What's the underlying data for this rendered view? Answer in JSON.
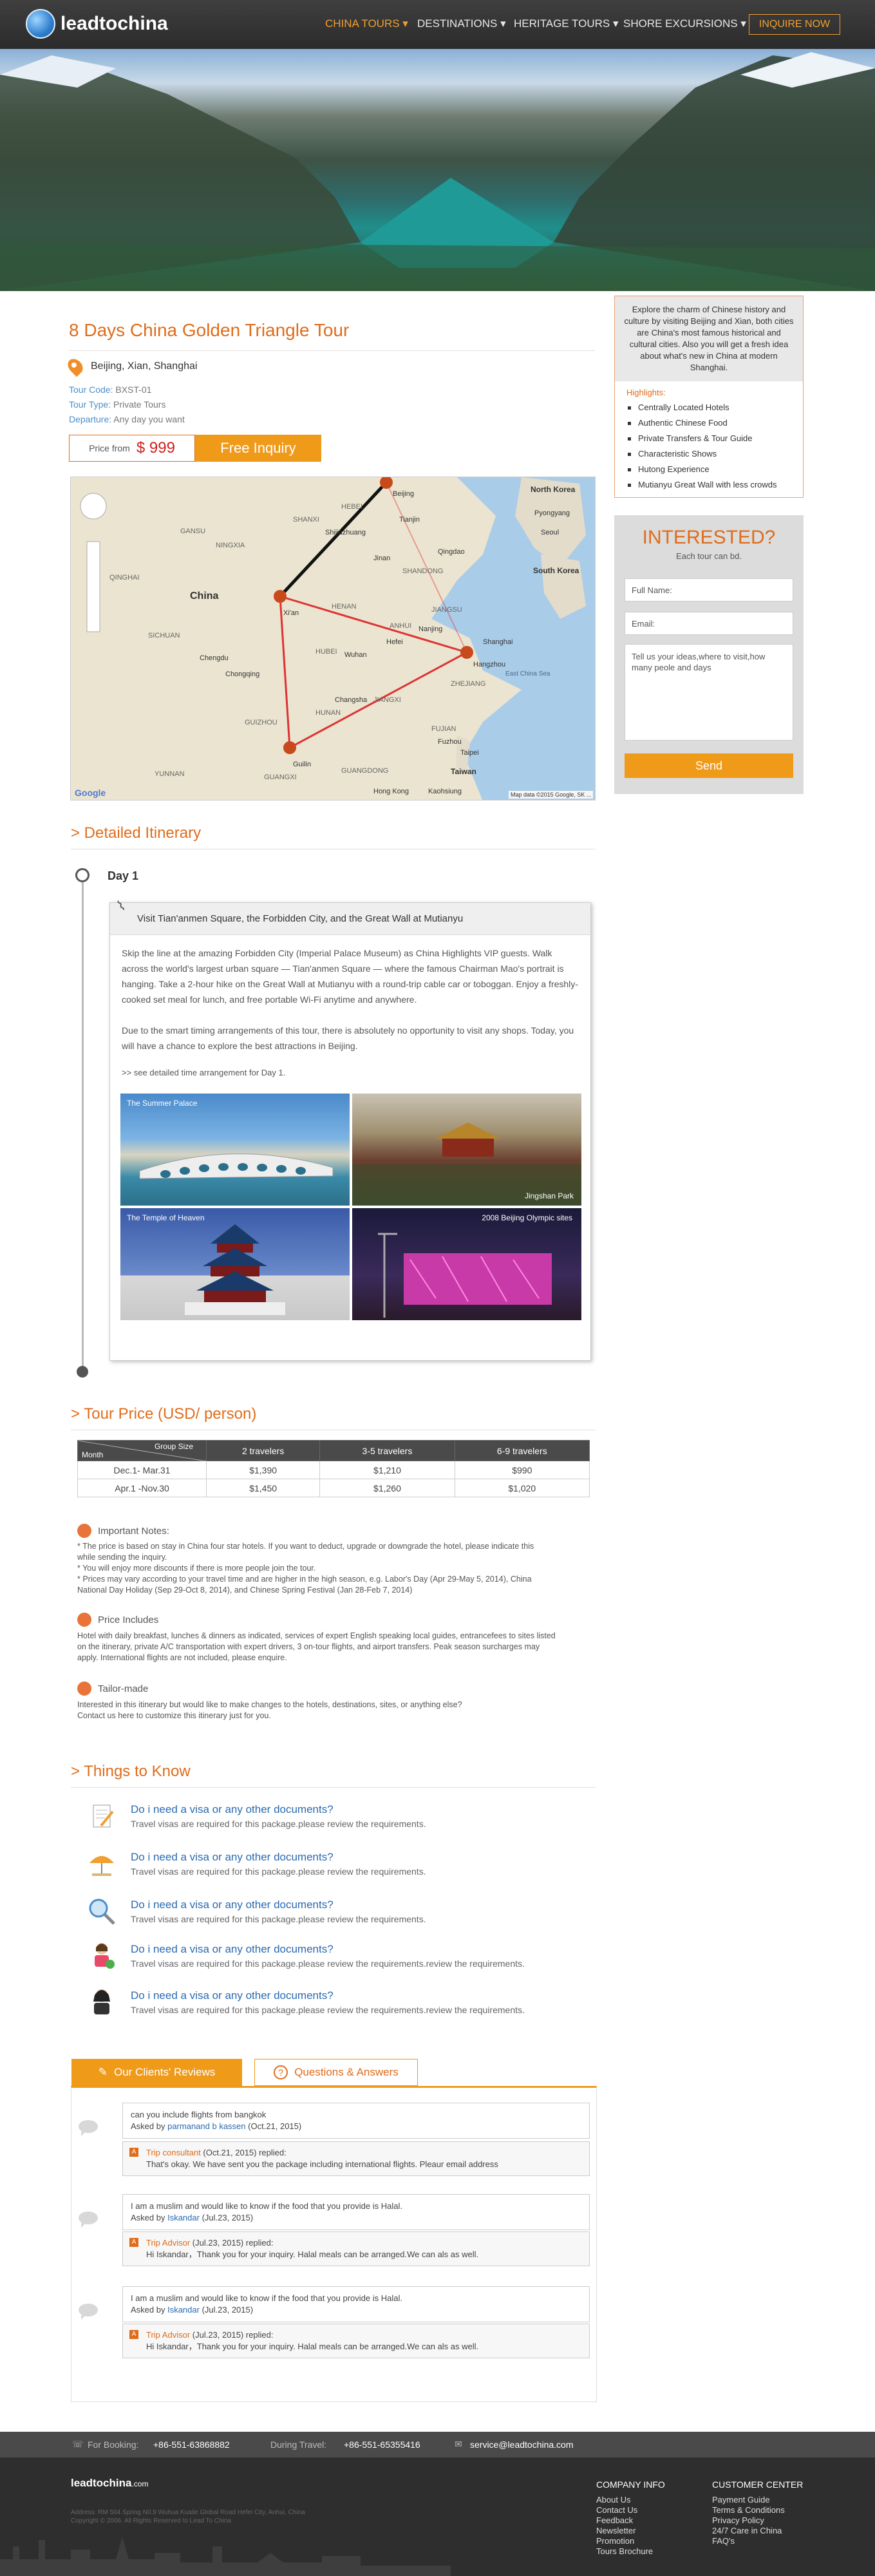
{
  "nav": {
    "logo": "leadtochina",
    "items": [
      "CHINA TOURS",
      "DESTINATIONS",
      "HERITAGE TOURS",
      "SHORE EXCURSIONS"
    ],
    "inquire": "INQUIRE NOW"
  },
  "tour": {
    "title": "8 Days China Golden Triangle Tour",
    "location": "Beijing, Xian, Shanghai",
    "code_label": "Tour Code:",
    "code": "BXST-01",
    "type_label": "Tour Type:",
    "type": "Private Tours",
    "dep_label": "Departure:",
    "departure": "Any day you want",
    "price_from": "Price from",
    "price": "$ 999",
    "free_inquiry": "Free Inquiry"
  },
  "map": {
    "labels": [
      "Beijing",
      "Tianjin",
      "North Korea",
      "Pyongyang",
      "Seoul",
      "South Korea",
      "SHANDONG",
      "Jinan",
      "Shijiazhuang",
      "GANSU",
      "NINGXIA",
      "SHANXI",
      "HEBEI",
      "Qingdao",
      "China",
      "Xi'an",
      "HENAN",
      "JIANGSU",
      "Nanjing",
      "Hefei",
      "Shanghai",
      "Hangzhou",
      "Wuhan",
      "Chengdu",
      "Chongqing",
      "HUBEI",
      "ANHUI",
      "ZHEJIANG",
      "HUNAN",
      "JIANGXI",
      "East China Sea",
      "GUIZHOU",
      "Changsha",
      "Guilin",
      "FUJIAN",
      "Fuzhou",
      "Taipei",
      "Taiwan",
      "YUNNAN",
      "GUANGXI",
      "GUANGDONG",
      "Hong Kong",
      "Kaohsiung",
      "QINGHAI",
      "SICHUAN"
    ],
    "footer": "Map data ©2015 Google, SK ...",
    "logo": "Google"
  },
  "sidebar": {
    "intro": "Explore the charm of Chinese history and culture by visiting Beijing and Xian, both cities are China's most famous historical and cultural cities. Also you will get a fresh idea about what's new in China at modern Shanghai.",
    "hl_title": "Highlights:",
    "highlights": [
      "Centrally Located Hotels",
      "Authentic Chinese Food",
      "Private Transfers & Tour Guide",
      "Characteristic Shows",
      "Hutong Experience",
      "Mutianyu Great Wall with less crowds"
    ],
    "int_title": "INTERESTED?",
    "int_sub": "Each tour can bd.",
    "name_ph": "Full Name:",
    "email_ph": "Email:",
    "msg_ph": "Tell us your ideas,where to visit,how many peole and days",
    "send": "Send"
  },
  "itinerary": {
    "title": "> Detailed Itinerary",
    "day": "Day 1",
    "head": "Visit Tian'anmen Square, the Forbidden City, and the Great Wall at Mutianyu",
    "p1": "Skip the line at the amazing Forbidden City (Imperial Palace Museum) as China Highlights VIP guests. Walk across the world's largest urban square — Tian'anmen Square — where the famous Chairman Mao's portrait is hanging. Take a 2-hour hike on the Great Wall at Mutianyu with a round-trip cable car or toboggan. Enjoy a freshly-cooked set meal for lunch, and free portable Wi-Fi anytime and anywhere.",
    "p2": "Due to the smart timing arrangements of this tour, there is absolutely no opportunity to visit any shops. Today, you will have a chance to explore the best attractions in Beijing.",
    "p3": ">> see detailed time arrangement for Day 1.",
    "photos": [
      "The Summer Palace",
      "Jingshan Park",
      "The Temple of Heaven",
      "2008 Beijing Olympic sites"
    ]
  },
  "price": {
    "title": "> Tour Price (USD/ person)",
    "corner_top": "Group Size",
    "corner_bottom": "Month",
    "cols": [
      "2 travelers",
      "3-5 travelers",
      "6-9 travelers"
    ],
    "rows": [
      [
        "Dec.1- Mar.31",
        "$1,390",
        "$1,210",
        "$990"
      ],
      [
        "Apr.1 -Nov.30",
        "$1,450",
        "$1,260",
        "$1,020"
      ]
    ]
  },
  "notes": {
    "imp_title": "Important Notes:",
    "imp1": "* The price is based on stay in China four star hotels. If you want to deduct, upgrade or downgrade the hotel,    please indicate this",
    "imp1b": "   while sending the inquiry.",
    "imp2": "* You will enjoy more discounts if there is more people join the tour.",
    "imp3": "* Prices may vary according to your travel time and are higher in the high season, e.g. Labor's Day (Apr 29-May 5, 2014), China",
    "imp3b": "  National Day Holiday (Sep 29-Oct 8, 2014), and Chinese Spring Festival (Jan 28-Feb 7, 2014)",
    "inc_title": "Price Includes",
    "inc1": "Hotel with daily breakfast, lunches & dinners as indicated, services of expert English speaking local guides, entrancefees to sites listed",
    "inc2": "on the itinerary, private A/C transportation with expert drivers, 3 on-tour flights, and airport transfers. Peak season surcharges may",
    "inc3": "apply. International flights are not included, please enquire.",
    "tm_title": "Tailor-made",
    "tm1": "Interested in this itinerary but would like to make changes to the hotels, destinations, sites, or anything else?",
    "tm2": "Contact us here to customize this itinerary just for you."
  },
  "know": {
    "title": "> Things to Know",
    "items": [
      {
        "q": "Do i need a visa or any other documents?",
        "a": "Travel visas are required for this package.please review the requirements.",
        "icon": "document-pen-icon"
      },
      {
        "q": "Do i need a visa or any other documents?",
        "a": "Travel visas are required for this package.please review the requirements.",
        "icon": "sun-umbrella-icon"
      },
      {
        "q": "Do i need a visa or any other documents?",
        "a": "Travel visas are required for this package.please review the requirements.",
        "icon": "magnifier-icon"
      },
      {
        "q": "Do i need a visa or any other documents?",
        "a": "Travel visas are required for this package.please review the requirements.review the requirements.",
        "icon": "traveler-icon"
      },
      {
        "q": "Do i need a visa or any other documents?",
        "a": "Travel visas are required for this package.please review the requirements.review the requirements.",
        "icon": "person-icon"
      }
    ]
  },
  "reviews": {
    "tab1": "Our Clients' Reviews",
    "tab2": "Questions & Answers",
    "qa": [
      {
        "q": "can you include flights from bangkok",
        "asked_by": "Asked by ",
        "asker": "parmanand b kassen",
        "date": " (Oct.21, 2015)",
        "responder": "Trip consultant",
        "rdate": " (Oct.21, 2015) replied:",
        "answer": "That's okay. We have sent you the package including international flights. Pleaur email address"
      },
      {
        "q": "I am a muslim and would like to know if the food that you provide is Halal.",
        "asked_by": "Asked by ",
        "asker": "Iskandar",
        "date": " (Jul.23, 2015)",
        "responder": "Trip Advisor",
        "rdate": " (Jul.23, 2015) replied:",
        "answer": "Hi Iskandar，Thank you for your inquiry. Halal meals can be arranged.We can als as well."
      },
      {
        "q": "I am a muslim and would like to know if the food that you provide is Halal.",
        "asked_by": "Asked by ",
        "asker": "Iskandar",
        "date": " (Jul.23, 2015)",
        "responder": "Trip Advisor",
        "rdate": " (Jul.23, 2015) replied:",
        "answer": "Hi Iskandar，Thank you for your inquiry. Halal meals can be arranged.We can als as well."
      }
    ]
  },
  "contact": {
    "booking_label": "For Booking:",
    "booking": "+86-551-63868882",
    "travel_label": "During Travel:",
    "travel": "+86-551-65355416",
    "email": "service@leadtochina.com"
  },
  "footer": {
    "logo": "leadtochina",
    "logo_suffix": ".com",
    "address": "Address: RM 504 Spring N0.9 Wuhua Kuaile Global Road Hefei City, Anhui, China",
    "copyright": "Copyright © 2006. All Rights Reserved to Lead To China",
    "col1_title": "COMPANY INFO",
    "col1": [
      "About Us",
      "Contact Us",
      "Feedback",
      "Newsletter",
      "Promotion",
      "Tours Brochure"
    ],
    "col2_title": "CUSTOMER CENTER",
    "col2": [
      "Payment Guide",
      "Terms & Conditions",
      "Privacy Policy",
      "24/7 Care in China",
      "FAQ's"
    ]
  }
}
